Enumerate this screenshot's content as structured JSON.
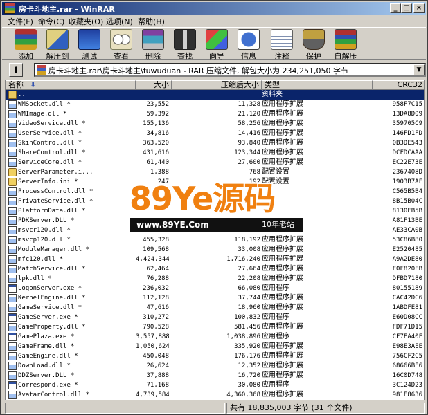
{
  "window": {
    "title": "房卡斗地主.rar - WinRAR",
    "minimize": "_",
    "maximize": "□",
    "close": "×"
  },
  "menu": [
    "文件(F)",
    "命令(C)",
    "收藏夹(O)",
    "选项(N)",
    "帮助(H)"
  ],
  "toolbar": [
    {
      "label": "添加",
      "icon": "add-archive-icon"
    },
    {
      "label": "解压到",
      "icon": "extract-to-icon"
    },
    {
      "label": "测试",
      "icon": "test-icon"
    },
    {
      "label": "查看",
      "icon": "view-icon"
    },
    {
      "label": "删除",
      "icon": "delete-icon"
    },
    {
      "label": "查找",
      "icon": "find-icon"
    },
    {
      "label": "向导",
      "icon": "wizard-icon"
    },
    {
      "label": "信息",
      "icon": "info-icon"
    },
    {
      "label": "注释",
      "icon": "comment-icon"
    },
    {
      "label": "保护",
      "icon": "protect-icon"
    },
    {
      "label": "自解压",
      "icon": "sfx-icon"
    }
  ],
  "address": {
    "up": "⬆",
    "text": "房卡斗地主.rar\\房卡斗地主\\fuwuduan - RAR 压缩文件, 解包大小为 234,251,050 字节",
    "dropdown": "▼"
  },
  "columns": {
    "name": "名称",
    "sort": "⬇",
    "size": "大小",
    "packed": "压缩后大小",
    "type": "类型",
    "crc": "CRC32"
  },
  "files": [
    {
      "name": "..",
      "size": "",
      "packed": "",
      "type": "资料夹",
      "crc": "",
      "kind": "folder",
      "selected": true
    },
    {
      "name": "WMSocket.dll *",
      "size": "23,552",
      "packed": "11,328",
      "type": "应用程序扩展",
      "crc": "958F7C15",
      "kind": "dll"
    },
    {
      "name": "WMImage.dll *",
      "size": "59,392",
      "packed": "21,120",
      "type": "应用程序扩展",
      "crc": "13DA8D09",
      "kind": "dll"
    },
    {
      "name": "VideoService.dll *",
      "size": "155,136",
      "packed": "58,256",
      "type": "应用程序扩展",
      "crc": "359705C9",
      "kind": "dll"
    },
    {
      "name": "UserService.dll *",
      "size": "34,816",
      "packed": "14,416",
      "type": "应用程序扩展",
      "crc": "146FD1FD",
      "kind": "dll"
    },
    {
      "name": "SkinControl.dll *",
      "size": "363,520",
      "packed": "93,840",
      "type": "应用程序扩展",
      "crc": "0B3DE543",
      "kind": "dll"
    },
    {
      "name": "ShareControl.dll *",
      "size": "431,616",
      "packed": "123,344",
      "type": "应用程序扩展",
      "crc": "DCFDCAAA",
      "kind": "dll"
    },
    {
      "name": "ServiceCore.dll *",
      "size": "61,440",
      "packed": "27,600",
      "type": "应用程序扩展",
      "crc": "EC22E73E",
      "kind": "dll"
    },
    {
      "name": "ServerParameter.i...",
      "size": "1,388",
      "packed": "768",
      "type": "配置设置",
      "crc": "2367408D",
      "kind": "ini"
    },
    {
      "name": "ServerInfo.ini *",
      "size": "247",
      "packed": "192",
      "type": "配置设置",
      "crc": "1903B7AF",
      "kind": "ini"
    },
    {
      "name": "ProcessControl.dll *",
      "size": "",
      "packed": "",
      "type": "",
      "crc": "C565B5B4",
      "kind": "dll"
    },
    {
      "name": "PrivateService.dll *",
      "size": "",
      "packed": "",
      "type": "",
      "crc": "8B15B04C",
      "kind": "dll"
    },
    {
      "name": "PlatformData.dll *",
      "size": "",
      "packed": "",
      "type": "",
      "crc": "8130EB5B",
      "kind": "dll"
    },
    {
      "name": "PDKServer.DLL *",
      "size": "",
      "packed": "",
      "type": "",
      "crc": "A81F13BE",
      "kind": "dll"
    },
    {
      "name": "msvcr120.dll *",
      "size": "",
      "packed": "",
      "type": "",
      "crc": "AE33CA0B",
      "kind": "dll"
    },
    {
      "name": "msvcp120.dll *",
      "size": "455,328",
      "packed": "118,192",
      "type": "应用程序扩展",
      "crc": "53C86B80",
      "kind": "dll"
    },
    {
      "name": "ModuleManager.dll *",
      "size": "109,568",
      "packed": "33,008",
      "type": "应用程序扩展",
      "crc": "E2520485",
      "kind": "dll"
    },
    {
      "name": "mfc120.dll *",
      "size": "4,424,344",
      "packed": "1,716,240",
      "type": "应用程序扩展",
      "crc": "A9A2DE80",
      "kind": "dll"
    },
    {
      "name": "MatchService.dll *",
      "size": "62,464",
      "packed": "27,664",
      "type": "应用程序扩展",
      "crc": "F0F820FB",
      "kind": "dll"
    },
    {
      "name": "lpk.dll *",
      "size": "76,288",
      "packed": "22,208",
      "type": "应用程序扩展",
      "crc": "DFBD7180",
      "kind": "dll"
    },
    {
      "name": "LogonServer.exe *",
      "size": "236,032",
      "packed": "66,080",
      "type": "应用程序",
      "crc": "80155189",
      "kind": "exe"
    },
    {
      "name": "KernelEngine.dll *",
      "size": "112,128",
      "packed": "37,744",
      "type": "应用程序扩展",
      "crc": "CAC42DC6",
      "kind": "dll"
    },
    {
      "name": "GameService.dll *",
      "size": "47,616",
      "packed": "18,960",
      "type": "应用程序扩展",
      "crc": "1ABDFE81",
      "kind": "dll"
    },
    {
      "name": "GameServer.exe *",
      "size": "310,272",
      "packed": "100,832",
      "type": "应用程序",
      "crc": "E60D08CC",
      "kind": "exe"
    },
    {
      "name": "GameProperty.dll *",
      "size": "790,528",
      "packed": "581,456",
      "type": "应用程序扩展",
      "crc": "FDF71D15",
      "kind": "dll"
    },
    {
      "name": "GamePlaza.exe *",
      "size": "3,557,888",
      "packed": "1,038,896",
      "type": "应用程序",
      "crc": "CF7EA40F",
      "kind": "exe"
    },
    {
      "name": "GameFrame.dll *",
      "size": "1,050,624",
      "packed": "335,920",
      "type": "应用程序扩展",
      "crc": "E98E3AEE",
      "kind": "dll"
    },
    {
      "name": "GameEngine.dll *",
      "size": "450,048",
      "packed": "176,176",
      "type": "应用程序扩展",
      "crc": "756CF2C5",
      "kind": "dll"
    },
    {
      "name": "DownLoad.dll *",
      "size": "26,624",
      "packed": "12,352",
      "type": "应用程序扩展",
      "crc": "68666BE6",
      "kind": "dll"
    },
    {
      "name": "DDZServer.DLL *",
      "size": "37,888",
      "packed": "16,720",
      "type": "应用程序扩展",
      "crc": "16C0D748",
      "kind": "dll"
    },
    {
      "name": "Correspond.exe *",
      "size": "71,168",
      "packed": "30,080",
      "type": "应用程序",
      "crc": "3C124D23",
      "kind": "exe"
    },
    {
      "name": "AvatarControl.dll *",
      "size": "4,739,584",
      "packed": "4,360,368",
      "type": "应用程序扩展",
      "crc": "981E8636",
      "kind": "dll"
    }
  ],
  "watermark": {
    "brand": "89Ye源码",
    "url": "www.89YE.Com",
    "slogan": "10年老站"
  },
  "status": {
    "left": "",
    "right": "共有 18,835,003 字节 (31 个文件)"
  }
}
